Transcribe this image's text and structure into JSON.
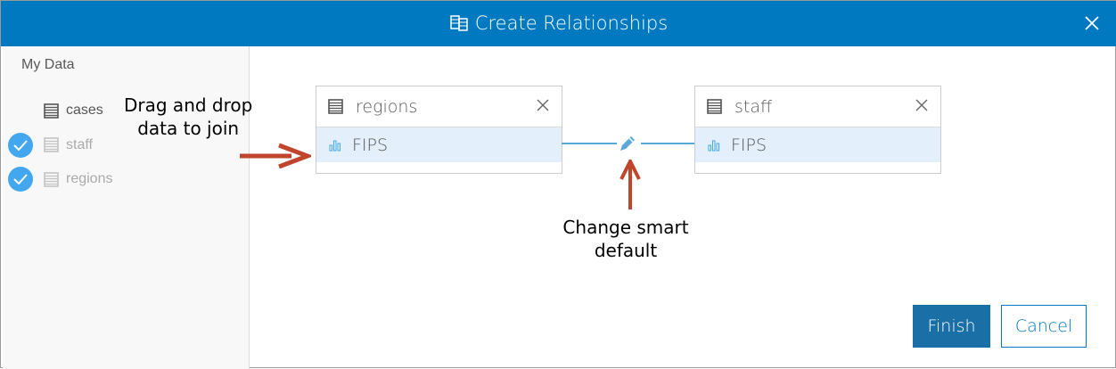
{
  "dialog": {
    "title": "Create Relationships"
  },
  "sidebar": {
    "title": "My Data",
    "items": [
      {
        "label": "cases",
        "checked": false
      },
      {
        "label": "staff",
        "checked": true
      },
      {
        "label": "regions",
        "checked": true
      }
    ]
  },
  "annotations": {
    "drag_line1": "Drag and drop",
    "drag_line2": "data to join",
    "change_line1": "Change smart",
    "change_line2": "default"
  },
  "cards": [
    {
      "name": "regions",
      "field": "FIPS"
    },
    {
      "name": "staff",
      "field": "FIPS"
    }
  ],
  "buttons": {
    "finish": "Finish",
    "cancel": "Cancel"
  },
  "colors": {
    "header": "#0079c1",
    "check": "#42a7ee",
    "arrow": "#c0452c",
    "finish": "#196fa6"
  }
}
